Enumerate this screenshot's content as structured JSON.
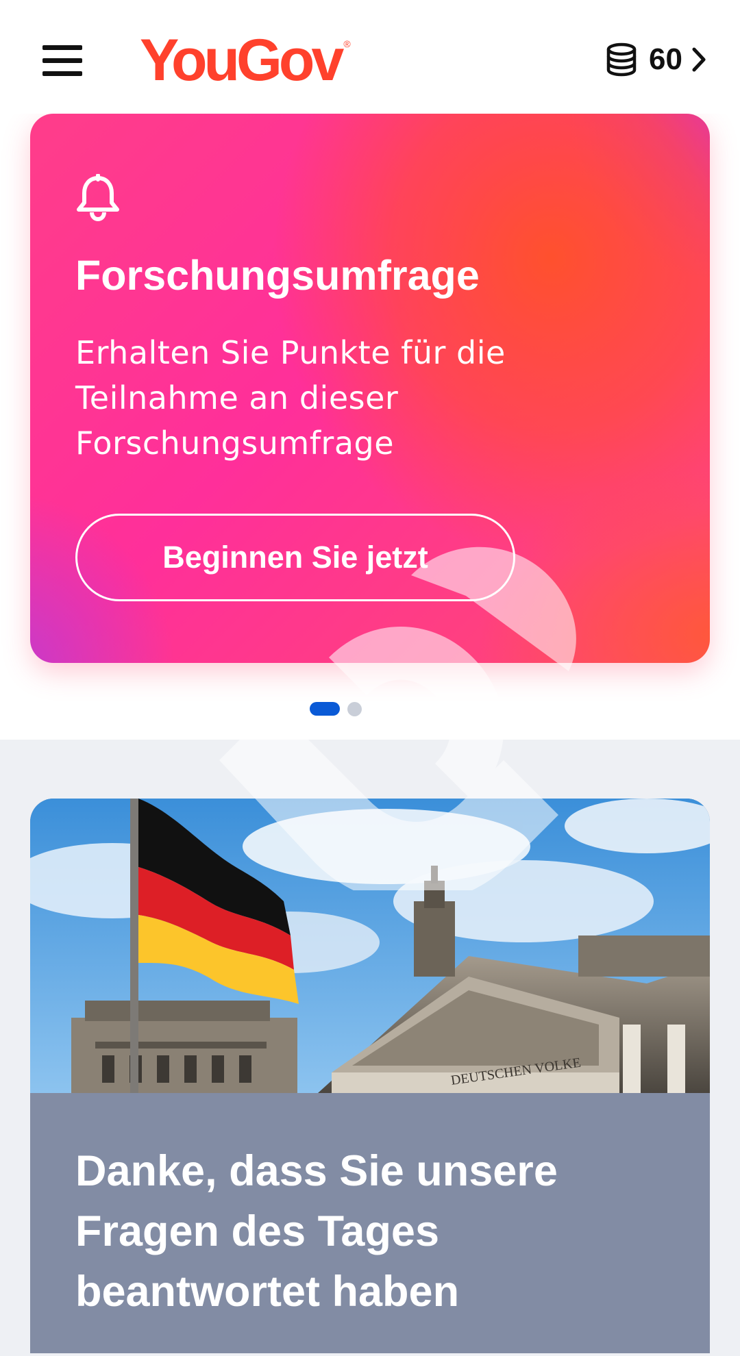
{
  "header": {
    "menu_icon": "hamburger-menu-icon",
    "logo_text": "YouGov",
    "logo_mark": "®",
    "coins_icon": "coins-icon",
    "points": "60",
    "chevron_icon": "chevron-right-icon"
  },
  "promo": {
    "icon": "bell-icon",
    "title": "Forschungsumfrage",
    "description": "Erhalten Sie Punkte für die Teilnahme an dieser Forschungsumfrage",
    "button_label": "Beginnen Sie jetzt"
  },
  "carousel": {
    "total": 2,
    "active_index": 0
  },
  "news": {
    "image": "german-flag-reichstag-photo",
    "title": "Danke, dass Sie unsere Fragen des Tages beantwortet haben"
  },
  "colors": {
    "brand": "#ff412c",
    "dot_active": "#0a5ad6",
    "dot_inactive": "#c9ced8",
    "news_panel": "#828ca4",
    "feed_bg": "#eef0f4"
  }
}
